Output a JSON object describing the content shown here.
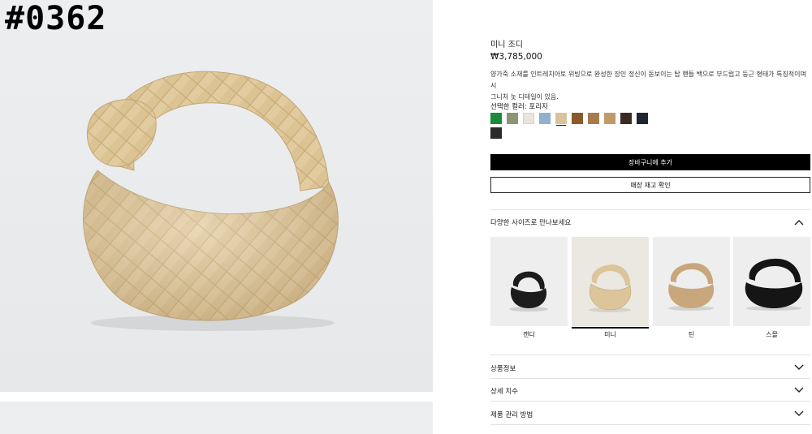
{
  "item_code": "#0362",
  "product": {
    "title": "미니 조디",
    "price": "₩3,785,000",
    "description_line1": "양가죽 소재를 인트레치아토 위빙으로 완성한 장인 정신이 돋보이는 탑 핸들 백으로 부드럽고 둥근 형태가 특징적이며 시",
    "description_line2": "그니처 놋 디테일이 있음."
  },
  "color": {
    "label": "선택한 컬러: 포리지",
    "swatches": [
      {
        "name": "green",
        "hex": "#1a8a3c"
      },
      {
        "name": "olive",
        "hex": "#8e9470"
      },
      {
        "name": "ivory",
        "hex": "#e9e5db"
      },
      {
        "name": "light-blue",
        "hex": "#8fb1cf"
      },
      {
        "name": "porridge",
        "hex": "#d9c39c",
        "selected": true
      },
      {
        "name": "brown",
        "hex": "#8b5a2b"
      },
      {
        "name": "caramel",
        "hex": "#a87b4f"
      },
      {
        "name": "tan",
        "hex": "#c19a6b"
      },
      {
        "name": "dark-brown",
        "hex": "#3a2c24"
      },
      {
        "name": "navy",
        "hex": "#1f2630"
      },
      {
        "name": "black",
        "hex": "#2b2b2b"
      }
    ]
  },
  "buttons": {
    "add_to_cart": "장바구니에 추가",
    "check_stock": "매장 재고 확인"
  },
  "sizes_section": {
    "title": "다양한 사이즈로 만나보세요",
    "items": [
      {
        "label": "캔디",
        "bag_color": "#1c1c1c"
      },
      {
        "label": "미니",
        "bag_color": "#dcc49b",
        "selected": true
      },
      {
        "label": "틴",
        "bag_color": "#c9a77c"
      },
      {
        "label": "스몰",
        "bag_color": "#151515"
      }
    ]
  },
  "accordions": [
    {
      "label": "상품정보"
    },
    {
      "label": "상세 치수"
    },
    {
      "label": "제품 관리 방법"
    }
  ]
}
